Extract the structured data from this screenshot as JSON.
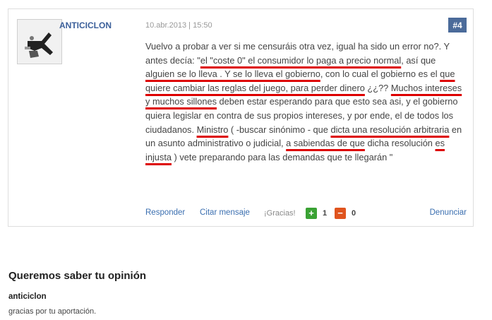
{
  "comment": {
    "username": "ANTICICLON",
    "timestamp": "10.abr.2013 | 15:50",
    "number": "#4",
    "body_segments": [
      {
        "text": "Vuelvo a probar a ver si me censuráis otra vez, igual ha sido un error no?. Y antes decía: \"",
        "hl": false
      },
      {
        "text": "el \"coste 0\" el consumidor lo paga a precio normal",
        "hl": true
      },
      {
        "text": ", así que ",
        "hl": false
      },
      {
        "text": "alguien se lo lleva . Y se lo lleva el gobierno",
        "hl": true
      },
      {
        "text": ", con lo cual el gobierno es el ",
        "hl": false
      },
      {
        "text": "que quiere cambiar las reglas del juego, para perder dinero",
        "hl": true
      },
      {
        "text": " ¿¿?? ",
        "hl": false
      },
      {
        "text": "Muchos intereses y muchos sillones",
        "hl": true
      },
      {
        "text": " deben estar esperando para que esto sea asi, y el gobierno quiera legislar en contra de sus propios intereses, y por ende, el de todos los ciudadanos. ",
        "hl": false
      },
      {
        "text": "Ministro",
        "hl": true
      },
      {
        "text": " ( -buscar sinónimo - que ",
        "hl": false
      },
      {
        "text": "dicta una resolución arbitraria",
        "hl": true
      },
      {
        "text": " en un asunto administrativo o judicial, ",
        "hl": false
      },
      {
        "text": "a sabiendas de que",
        "hl": true
      },
      {
        "text": " dicha resolución ",
        "hl": false
      },
      {
        "text": "es",
        "hl": true
      },
      {
        "text": " ",
        "hl": false
      },
      {
        "text": "injusta",
        "hl": true
      },
      {
        "text": " ) vete preparando para las demandas que te llegarán \"",
        "hl": false
      }
    ],
    "actions": {
      "reply": "Responder",
      "quote": "Citar mensaje",
      "thanks_label": "¡Gracias!",
      "plus_symbol": "+",
      "plus_count": "1",
      "minus_symbol": "−",
      "minus_count": "0",
      "report": "Denunciar"
    },
    "colors": {
      "number_badge": "#4b6b9a",
      "highlight": "#dd0000",
      "plus": "#3aa234",
      "minus": "#e0541e",
      "link": "#3b6fb0"
    }
  },
  "opinion_section": {
    "title": "Queremos saber tu opinión",
    "reply_author": "anticiclon",
    "reply_text": "gracias por tu aportación."
  }
}
